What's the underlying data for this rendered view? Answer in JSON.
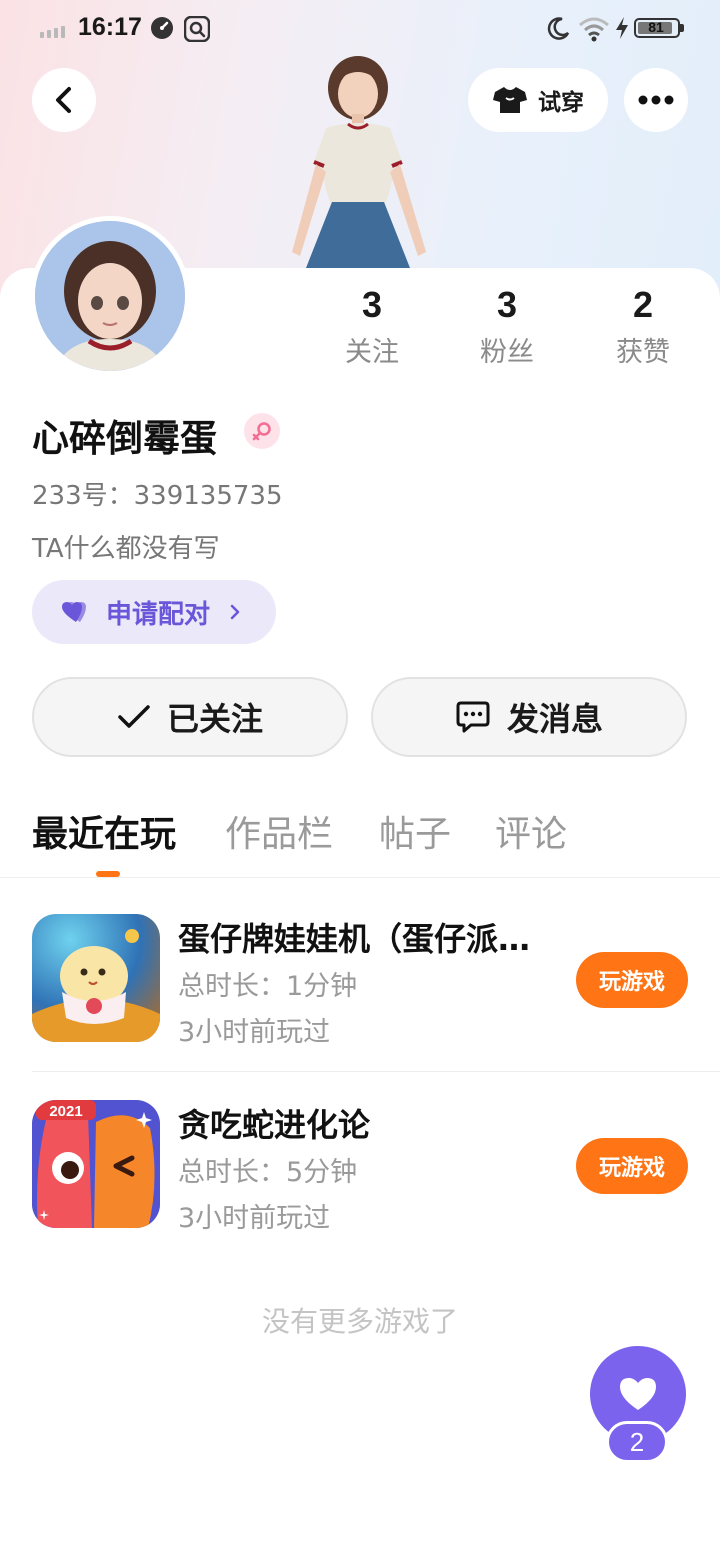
{
  "status_bar": {
    "time": "16:17",
    "battery": "81",
    "icons": [
      "signal-icon",
      "speedometer-icon",
      "search-app-icon",
      "moon-icon",
      "wifi-icon",
      "charging-icon",
      "battery-icon"
    ]
  },
  "header": {
    "back_icon": "back-arrow-icon",
    "tryon_label": "试穿",
    "tryon_icon": "shirt-icon",
    "more_icon": "more-dots-icon"
  },
  "profile": {
    "username": "心碎倒霉蛋",
    "gender": "female-icon",
    "uid": "233号：339135735",
    "bio": "TA什么都没有写",
    "pair_label": "申请配对",
    "stats": [
      {
        "value": "3",
        "label": "关注"
      },
      {
        "value": "3",
        "label": "粉丝"
      },
      {
        "value": "2",
        "label": "获赞"
      }
    ]
  },
  "actions": {
    "follow_label": "已关注",
    "message_label": "发消息"
  },
  "tabs": [
    "最近在玩",
    "作品栏",
    "帖子",
    "评论"
  ],
  "games": [
    {
      "title": "蛋仔牌娃娃机（蛋仔派…",
      "duration": "总时长：1分钟",
      "last_played": "3小时前玩过",
      "button": "玩游戏"
    },
    {
      "title": "贪吃蛇进化论",
      "duration": "总时长：5分钟",
      "last_played": "3小时前玩过",
      "button": "玩游戏",
      "badge": "2021"
    }
  ],
  "footer_note": "没有更多游戏了",
  "like": {
    "count": "2"
  },
  "colors": {
    "accent_orange": "#ff7414",
    "accent_purple": "#7c63ee",
    "pair_bg": "#ebe8fa",
    "pair_text": "#6a56d8"
  }
}
